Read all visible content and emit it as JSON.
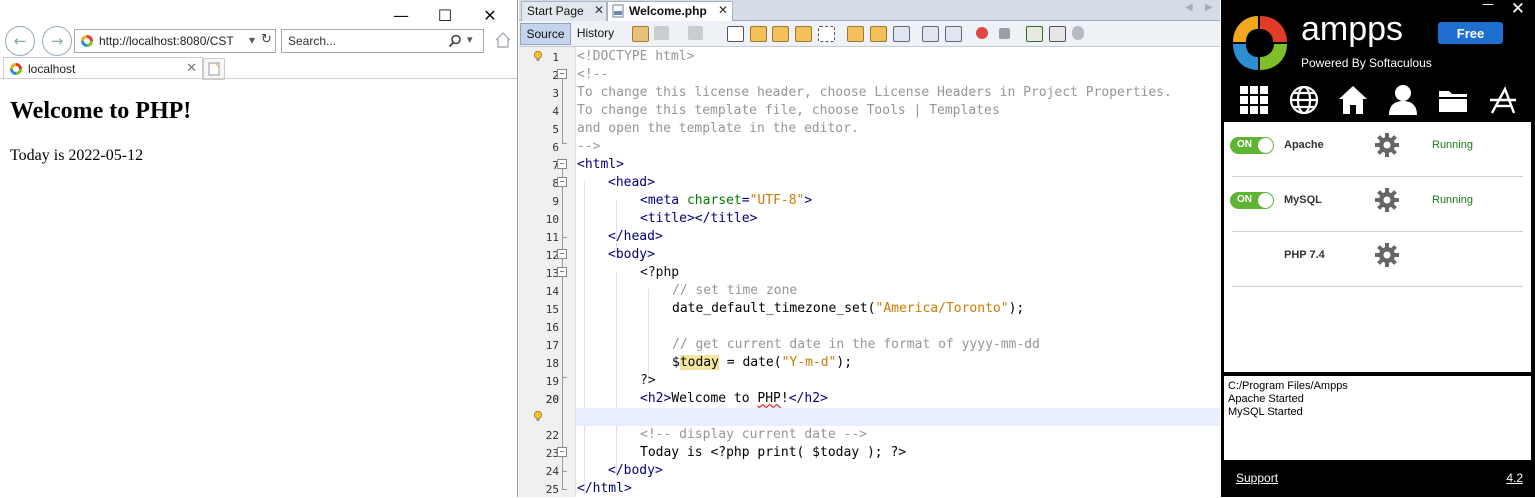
{
  "browser": {
    "url": "http://localhost:8080/CST",
    "search_placeholder": "Search...",
    "tab_title": "localhost",
    "page_heading": "Welcome to PHP!",
    "page_text": "Today is 2022-05-12"
  },
  "ide": {
    "tabs": [
      {
        "label": "Start Page"
      },
      {
        "label": "Welcome.php"
      }
    ],
    "source_label": "Source",
    "history_label": "History",
    "line_numbers": [
      "1",
      "2",
      "3",
      "4",
      "5",
      "6",
      "7",
      "8",
      "9",
      "10",
      "11",
      "12",
      "13",
      "14",
      "15",
      "16",
      "17",
      "18",
      "19",
      "20",
      "21",
      "22",
      "23",
      "24",
      "25"
    ],
    "lines": {
      "l1": "<!DOCTYPE html>",
      "l2": "<!--",
      "l3": "To change this license header, choose License Headers in Project Properties.",
      "l4": "To change this template file, choose Tools | Templates",
      "l5": "and open the template in the editor.",
      "l6": "-->",
      "l7": "<html>",
      "l8": "<head>",
      "l9_tag": "<meta",
      "l9_attr": "charset",
      "l9_eq": "=",
      "l9_val": "\"UTF-8\"",
      "l9_end": ">",
      "l10": "<title></title>",
      "l11": "</head>",
      "l12": "<body>",
      "l13": "<?php",
      "l14": "// set time zone",
      "l15_a": "date_default_timezone_set(",
      "l15_b": "\"America/Toronto\"",
      "l15_c": ");",
      "l17": "// get current date in the format of yyyy-mm-dd",
      "l18_a": "$",
      "l18_b": "today",
      "l18_c": " = date(",
      "l18_d": "\"Y-m-d\"",
      "l18_e": ");",
      "l19": "?>",
      "l20_a": "<h2>",
      "l20_b": "Welcome to ",
      "l20_c": "PHP",
      "l20_d": "!",
      "l20_e": "</h2>",
      "l22": "<!-- display current date -->",
      "l23": "Today is <?php print( $today ); ?>",
      "l24": "</body>",
      "l25": "</html>"
    }
  },
  "ampps": {
    "title": "ampps",
    "subtitle": "Powered By Softaculous",
    "free_label": "Free",
    "services": [
      {
        "toggle": "ON",
        "name": "Apache",
        "status": "Running"
      },
      {
        "toggle": "ON",
        "name": "MySQL",
        "status": "Running"
      },
      {
        "toggle": "",
        "name": "PHP 7.4",
        "status": ""
      }
    ],
    "log": [
      "C:/Program Files/Ampps",
      "Apache Started",
      "MySQL Started"
    ],
    "support_label": "Support",
    "version": "4.2"
  },
  "colors": {
    "ampps_green": "#5fb533",
    "ampps_blue": "#1e6fd0",
    "ide_comment": "#969696",
    "ide_tag": "#00007f",
    "ide_string": "#ce7b00"
  }
}
